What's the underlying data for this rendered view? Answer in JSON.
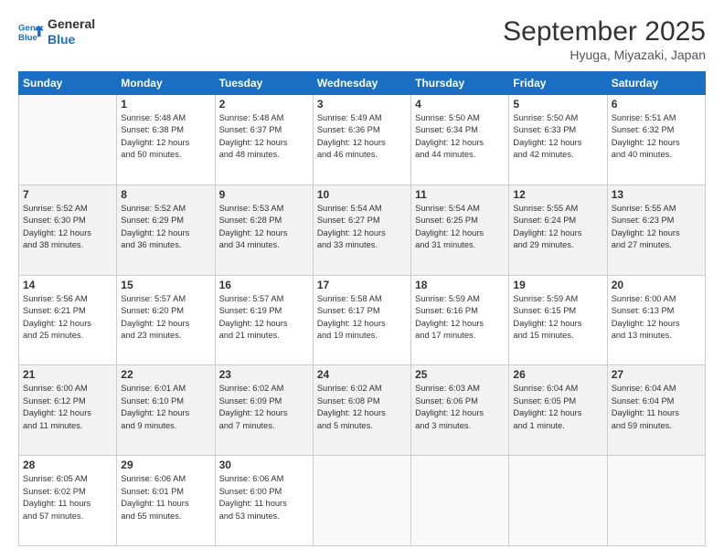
{
  "header": {
    "logo_line1": "General",
    "logo_line2": "Blue",
    "month_title": "September 2025",
    "location": "Hyuga, Miyazaki, Japan"
  },
  "days_of_week": [
    "Sunday",
    "Monday",
    "Tuesday",
    "Wednesday",
    "Thursday",
    "Friday",
    "Saturday"
  ],
  "weeks": [
    [
      {
        "num": "",
        "info": ""
      },
      {
        "num": "1",
        "info": "Sunrise: 5:48 AM\nSunset: 6:38 PM\nDaylight: 12 hours\nand 50 minutes."
      },
      {
        "num": "2",
        "info": "Sunrise: 5:48 AM\nSunset: 6:37 PM\nDaylight: 12 hours\nand 48 minutes."
      },
      {
        "num": "3",
        "info": "Sunrise: 5:49 AM\nSunset: 6:36 PM\nDaylight: 12 hours\nand 46 minutes."
      },
      {
        "num": "4",
        "info": "Sunrise: 5:50 AM\nSunset: 6:34 PM\nDaylight: 12 hours\nand 44 minutes."
      },
      {
        "num": "5",
        "info": "Sunrise: 5:50 AM\nSunset: 6:33 PM\nDaylight: 12 hours\nand 42 minutes."
      },
      {
        "num": "6",
        "info": "Sunrise: 5:51 AM\nSunset: 6:32 PM\nDaylight: 12 hours\nand 40 minutes."
      }
    ],
    [
      {
        "num": "7",
        "info": "Sunrise: 5:52 AM\nSunset: 6:30 PM\nDaylight: 12 hours\nand 38 minutes."
      },
      {
        "num": "8",
        "info": "Sunrise: 5:52 AM\nSunset: 6:29 PM\nDaylight: 12 hours\nand 36 minutes."
      },
      {
        "num": "9",
        "info": "Sunrise: 5:53 AM\nSunset: 6:28 PM\nDaylight: 12 hours\nand 34 minutes."
      },
      {
        "num": "10",
        "info": "Sunrise: 5:54 AM\nSunset: 6:27 PM\nDaylight: 12 hours\nand 33 minutes."
      },
      {
        "num": "11",
        "info": "Sunrise: 5:54 AM\nSunset: 6:25 PM\nDaylight: 12 hours\nand 31 minutes."
      },
      {
        "num": "12",
        "info": "Sunrise: 5:55 AM\nSunset: 6:24 PM\nDaylight: 12 hours\nand 29 minutes."
      },
      {
        "num": "13",
        "info": "Sunrise: 5:55 AM\nSunset: 6:23 PM\nDaylight: 12 hours\nand 27 minutes."
      }
    ],
    [
      {
        "num": "14",
        "info": "Sunrise: 5:56 AM\nSunset: 6:21 PM\nDaylight: 12 hours\nand 25 minutes."
      },
      {
        "num": "15",
        "info": "Sunrise: 5:57 AM\nSunset: 6:20 PM\nDaylight: 12 hours\nand 23 minutes."
      },
      {
        "num": "16",
        "info": "Sunrise: 5:57 AM\nSunset: 6:19 PM\nDaylight: 12 hours\nand 21 minutes."
      },
      {
        "num": "17",
        "info": "Sunrise: 5:58 AM\nSunset: 6:17 PM\nDaylight: 12 hours\nand 19 minutes."
      },
      {
        "num": "18",
        "info": "Sunrise: 5:59 AM\nSunset: 6:16 PM\nDaylight: 12 hours\nand 17 minutes."
      },
      {
        "num": "19",
        "info": "Sunrise: 5:59 AM\nSunset: 6:15 PM\nDaylight: 12 hours\nand 15 minutes."
      },
      {
        "num": "20",
        "info": "Sunrise: 6:00 AM\nSunset: 6:13 PM\nDaylight: 12 hours\nand 13 minutes."
      }
    ],
    [
      {
        "num": "21",
        "info": "Sunrise: 6:00 AM\nSunset: 6:12 PM\nDaylight: 12 hours\nand 11 minutes."
      },
      {
        "num": "22",
        "info": "Sunrise: 6:01 AM\nSunset: 6:10 PM\nDaylight: 12 hours\nand 9 minutes."
      },
      {
        "num": "23",
        "info": "Sunrise: 6:02 AM\nSunset: 6:09 PM\nDaylight: 12 hours\nand 7 minutes."
      },
      {
        "num": "24",
        "info": "Sunrise: 6:02 AM\nSunset: 6:08 PM\nDaylight: 12 hours\nand 5 minutes."
      },
      {
        "num": "25",
        "info": "Sunrise: 6:03 AM\nSunset: 6:06 PM\nDaylight: 12 hours\nand 3 minutes."
      },
      {
        "num": "26",
        "info": "Sunrise: 6:04 AM\nSunset: 6:05 PM\nDaylight: 12 hours\nand 1 minute."
      },
      {
        "num": "27",
        "info": "Sunrise: 6:04 AM\nSunset: 6:04 PM\nDaylight: 11 hours\nand 59 minutes."
      }
    ],
    [
      {
        "num": "28",
        "info": "Sunrise: 6:05 AM\nSunset: 6:02 PM\nDaylight: 11 hours\nand 57 minutes."
      },
      {
        "num": "29",
        "info": "Sunrise: 6:06 AM\nSunset: 6:01 PM\nDaylight: 11 hours\nand 55 minutes."
      },
      {
        "num": "30",
        "info": "Sunrise: 6:06 AM\nSunset: 6:00 PM\nDaylight: 11 hours\nand 53 minutes."
      },
      {
        "num": "",
        "info": ""
      },
      {
        "num": "",
        "info": ""
      },
      {
        "num": "",
        "info": ""
      },
      {
        "num": "",
        "info": ""
      }
    ]
  ]
}
